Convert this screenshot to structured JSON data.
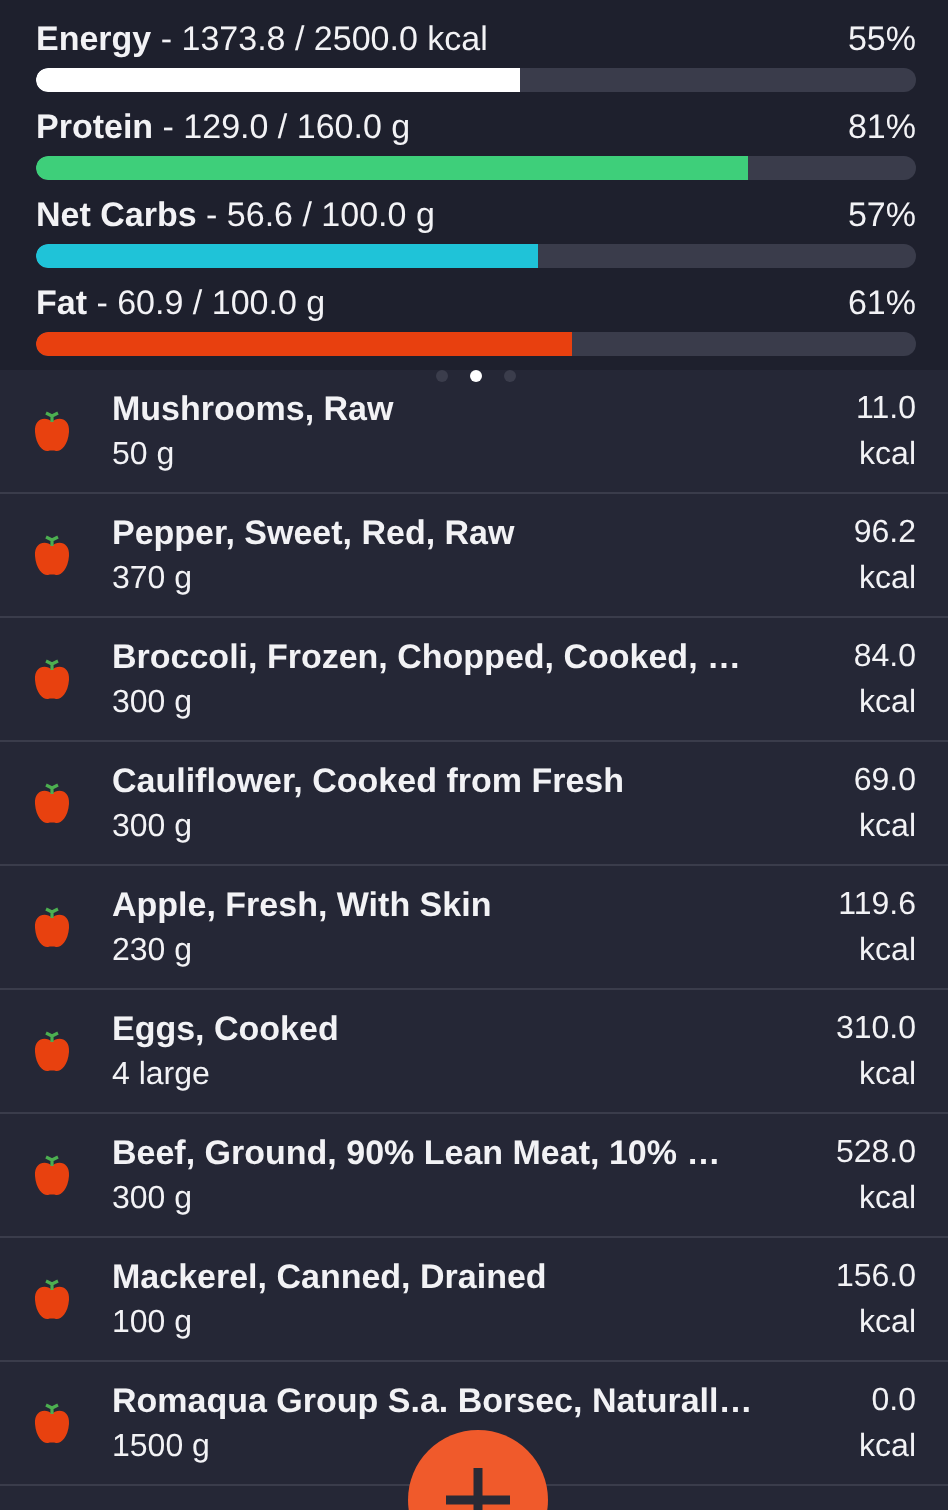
{
  "nutrients": [
    {
      "name": "Energy",
      "amount": " - 1373.8 / 2500.0 kcal",
      "percent": "55%",
      "level": 0.55,
      "color": "#ffffff"
    },
    {
      "name": "Protein",
      "amount": " - 129.0 / 160.0 g",
      "percent": "81%",
      "level": 0.81,
      "color": "#3ecf7a"
    },
    {
      "name": "Net Carbs",
      "amount": " - 56.6 / 100.0 g",
      "percent": "57%",
      "level": 0.57,
      "color": "#1fc3d8"
    },
    {
      "name": "Fat",
      "amount": " - 60.9 / 100.0 g",
      "percent": "61%",
      "level": 0.61,
      "color": "#e8400f"
    }
  ],
  "pager": [
    {
      "selected": false
    },
    {
      "selected": true
    },
    {
      "selected": false
    }
  ],
  "foods": [
    {
      "name": "Mushrooms, Raw",
      "quantity": "50 g",
      "calories": "11.0",
      "unit": "kcal"
    },
    {
      "name": "Pepper, Sweet, Red, Raw",
      "quantity": "370 g",
      "calories": "96.2",
      "unit": "kcal"
    },
    {
      "name": "Broccoli, Frozen, Chopped, Cooked, …",
      "quantity": "300 g",
      "calories": "84.0",
      "unit": "kcal"
    },
    {
      "name": "Cauliflower, Cooked from Fresh",
      "quantity": "300 g",
      "calories": "69.0",
      "unit": "kcal"
    },
    {
      "name": "Apple, Fresh, With Skin",
      "quantity": "230 g",
      "calories": "119.6",
      "unit": "kcal"
    },
    {
      "name": "Eggs, Cooked",
      "quantity": "4 large",
      "calories": "310.0",
      "unit": "kcal"
    },
    {
      "name": "Beef, Ground, 90% Lean Meat, 10% …",
      "quantity": "300 g",
      "calories": "528.0",
      "unit": "kcal"
    },
    {
      "name": "Mackerel, Canned, Drained",
      "quantity": "100 g",
      "calories": "156.0",
      "unit": "kcal"
    },
    {
      "name": "Romaqua Group S.a. Borsec, Naturall…",
      "quantity": "1500 g",
      "calories": "0.0",
      "unit": "kcal"
    }
  ],
  "add_button": {
    "kind": "add"
  }
}
